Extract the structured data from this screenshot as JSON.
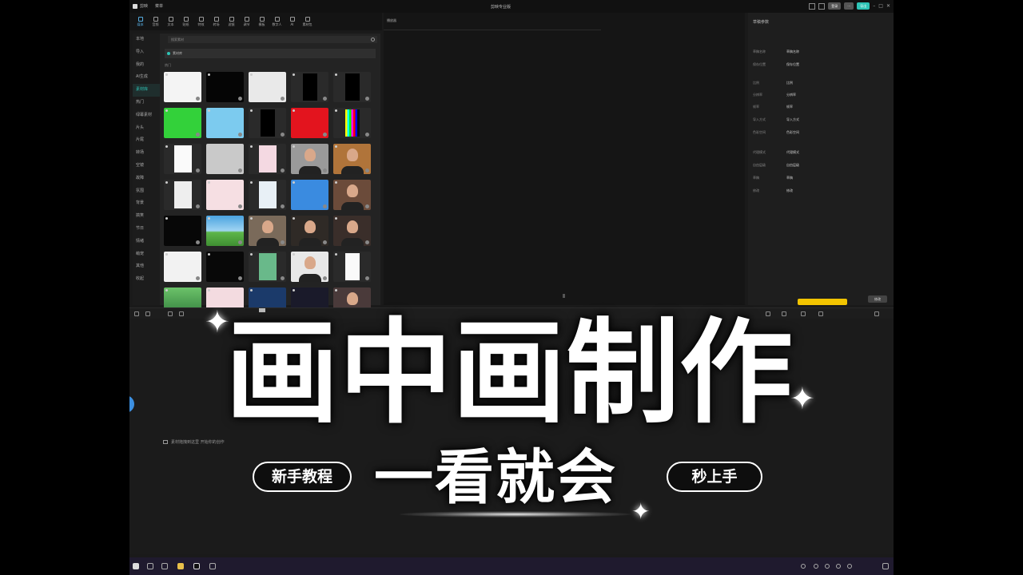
{
  "app": {
    "name": "剪映",
    "menu_label": "菜单",
    "window_title": "剪映专业版",
    "login_label": "登录",
    "export_label": "导出"
  },
  "toolbar": {
    "items": [
      {
        "label": "媒体",
        "icon": "media-icon",
        "active": true
      },
      {
        "label": "音频",
        "icon": "audio-icon"
      },
      {
        "label": "文本",
        "icon": "text-icon"
      },
      {
        "label": "贴纸",
        "icon": "sticker-icon"
      },
      {
        "label": "特效",
        "icon": "effects-icon"
      },
      {
        "label": "转场",
        "icon": "transition-icon"
      },
      {
        "label": "滤镜",
        "icon": "filter-icon"
      },
      {
        "label": "调节",
        "icon": "adjust-icon"
      },
      {
        "label": "模板",
        "icon": "template-icon"
      },
      {
        "label": "数字人",
        "icon": "avatar-icon"
      },
      {
        "label": "AI",
        "icon": "ai-icon"
      },
      {
        "label": "素材包",
        "icon": "package-icon"
      }
    ]
  },
  "leftnav": {
    "items": [
      {
        "label": "本地"
      },
      {
        "label": "导入"
      },
      {
        "label": "我的"
      },
      {
        "label": "AI生成"
      },
      {
        "label": "素材库",
        "active": true
      },
      {
        "label": "热门"
      },
      {
        "label": "绿幕素材"
      },
      {
        "label": "片头"
      },
      {
        "label": "片尾"
      },
      {
        "label": "转场"
      },
      {
        "label": "空镜"
      },
      {
        "label": "故障"
      },
      {
        "label": "氛围"
      },
      {
        "label": "背景"
      },
      {
        "label": "搞笑"
      },
      {
        "label": "节日"
      },
      {
        "label": "情绪"
      },
      {
        "label": "萌宠"
      },
      {
        "label": "其他"
      },
      {
        "label": "收起"
      }
    ]
  },
  "media": {
    "search_placeholder": "搜索素材",
    "banner_text": "素材库",
    "section_label": "热门"
  },
  "player": {
    "header": "播放器"
  },
  "props": {
    "header": "草稿参数",
    "rows": [
      {
        "k": "草稿名称",
        "v": "草稿名称"
      },
      {
        "k": "保存位置",
        "v": "保存位置"
      },
      {
        "k": "比例",
        "v": "比例"
      },
      {
        "k": "分辨率",
        "v": "分辨率"
      },
      {
        "k": "帧率",
        "v": "帧率"
      },
      {
        "k": "导入方式",
        "v": "导入方式"
      },
      {
        "k": "色彩空间",
        "v": "色彩空间"
      },
      {
        "k": "代理模式",
        "v": "代理模式"
      },
      {
        "k": "自由层级",
        "v": "自由层级"
      },
      {
        "k": "草稿",
        "v": "草稿"
      },
      {
        "k": "修改",
        "v": "修改"
      }
    ],
    "edit_label": "修改"
  },
  "timeline": {
    "hint": "素材拖拽到这里 开始你的创作"
  },
  "overlay": {
    "title": "画中画制作",
    "subtitle": "一看就会",
    "tag_left": "新手教程",
    "tag_right": "秒上手"
  },
  "colors": {
    "accent": "#2ec4b6",
    "highlight": "#f2c400"
  }
}
